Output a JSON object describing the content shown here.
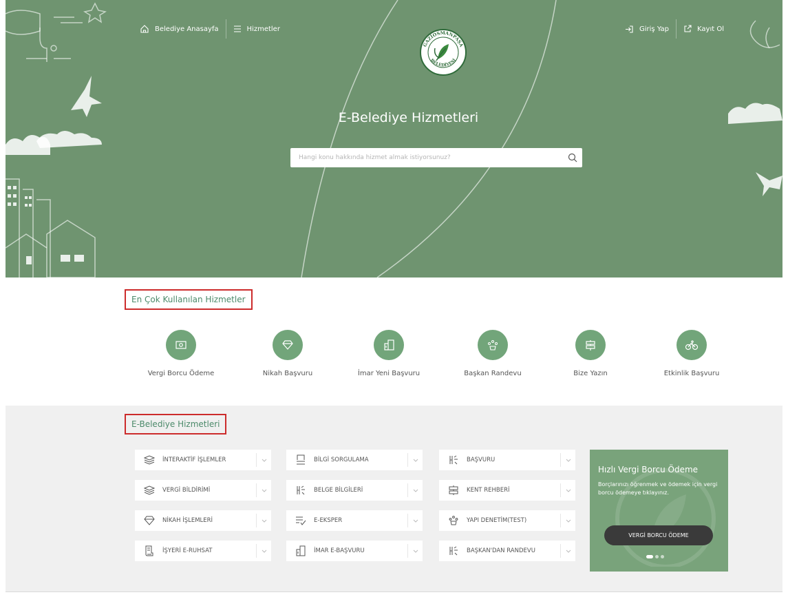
{
  "nav": {
    "home": "Belediye Anasayfa",
    "services": "Hizmetler",
    "login": "Giriş Yap",
    "register": "Kayıt Ol"
  },
  "logo": {
    "text_top": "GAZİOSMANPAŞA",
    "text_bottom": "BELEDİYESİ"
  },
  "hero": {
    "title": "E-Belediye Hizmetleri",
    "search_placeholder": "Hangi konu hakkında hizmet almak istiyorsunuz?"
  },
  "popular": {
    "title": "En Çok Kullanılan Hizmetler",
    "items": [
      {
        "label": "Vergi Borcu Ödeme",
        "icon": "money-icon"
      },
      {
        "label": "Nikah Başvuru",
        "icon": "diamond-icon"
      },
      {
        "label": "İmar Yeni Başvuru",
        "icon": "building-plan-icon"
      },
      {
        "label": "Başkan Randevu",
        "icon": "meeting-icon"
      },
      {
        "label": "Bize Yazın",
        "icon": "signpost-icon"
      },
      {
        "label": "Etkinlik Başvuru",
        "icon": "bicycle-icon"
      }
    ]
  },
  "services": {
    "title": "E-Belediye Hizmetleri",
    "items": [
      {
        "label": "İNTERAKTİF İŞLEMLER",
        "icon": "layers-icon"
      },
      {
        "label": "BİLGİ SORGULAMA",
        "icon": "inbox-icon"
      },
      {
        "label": "BAŞVURU",
        "icon": "hand-icon"
      },
      {
        "label": "VERGİ BİLDİRİMİ",
        "icon": "layers-icon"
      },
      {
        "label": "BELGE BİLGİLERİ",
        "icon": "hand-icon"
      },
      {
        "label": "KENT REHBERİ",
        "icon": "signpost-icon"
      },
      {
        "label": "NİKAH İŞLEMLERİ",
        "icon": "diamond-icon"
      },
      {
        "label": "E-EKSPER",
        "icon": "list-check-icon"
      },
      {
        "label": "YAPI DENETİM(TEST)",
        "icon": "meeting-icon"
      },
      {
        "label": "İŞYERİ E-RUHSAT",
        "icon": "license-icon"
      },
      {
        "label": "İMAR E-BAŞVURU",
        "icon": "building-plan-icon"
      },
      {
        "label": "BAŞKAN'DAN RANDEVU",
        "icon": "hand-icon"
      }
    ]
  },
  "quickpay": {
    "title": "Hızlı Vergi Borcu Ödeme",
    "description": "Borçlarınızı öğrenmek ve ödemek için vergi borcu ödemeye tıklayınız.",
    "button": "VERGİ BORCU ÖDEME"
  },
  "colors": {
    "hero_bg": "#6f9470",
    "icon_circle": "#72a57a",
    "accent_text": "#4c8a6a",
    "highlight_border": "#cc2b2b",
    "quickpay_bg": "#79a37b",
    "button_dark": "#3a3a3a"
  }
}
